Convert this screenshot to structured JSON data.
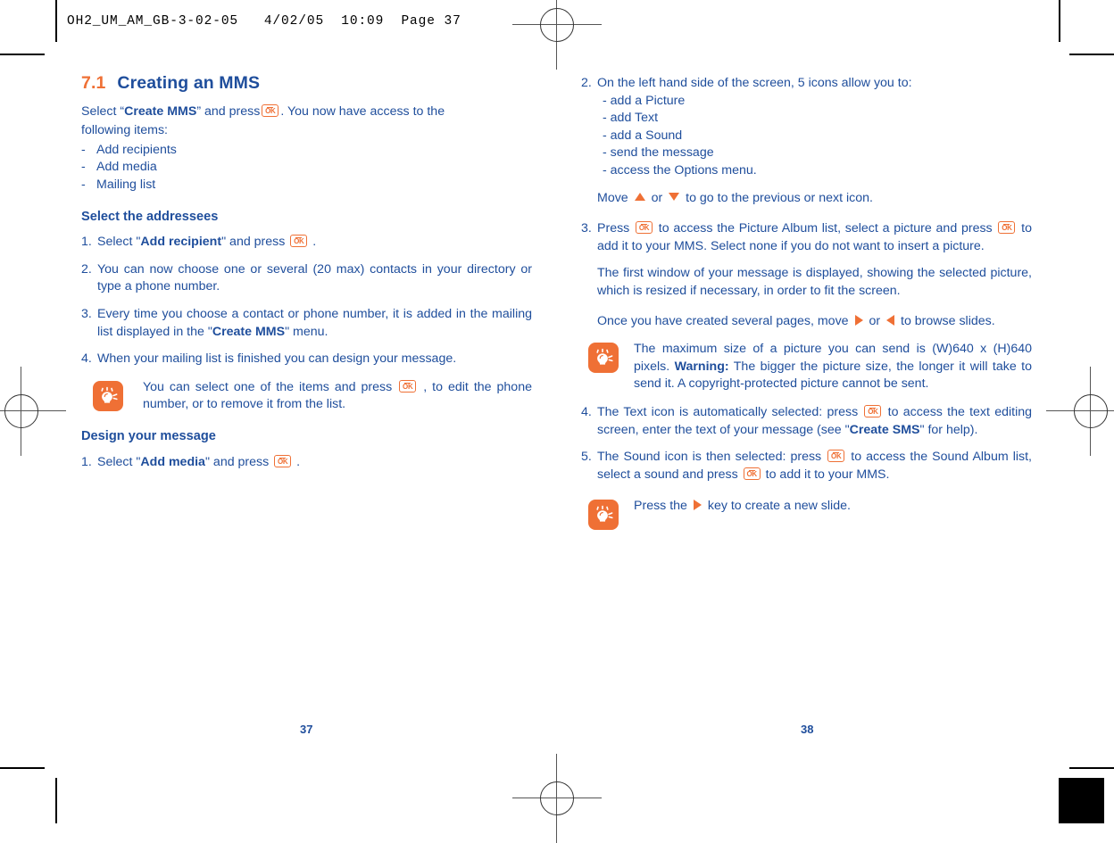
{
  "print_slug": {
    "text": "OH2_UM_AM_GB-3-02-05   4/02/05  10:09  Page 37"
  },
  "colors": {
    "accent_orange": "#ef7035",
    "text_blue": "#1f4e9c",
    "crop_mark": "#000000"
  },
  "left_page": {
    "page_number": "37",
    "chapter": {
      "number": "7.1",
      "title": "Creating an MMS"
    },
    "intro": {
      "before": "Select “",
      "bold": "Create MMS",
      "after_bold": "” and press",
      "after_key": ". You now have access to the",
      "line2": "following items:"
    },
    "items_list": [
      {
        "mark": "-",
        "label": "Add recipients"
      },
      {
        "mark": "-",
        "label": "Add media"
      },
      {
        "mark": "-",
        "label": "Mailing list"
      }
    ],
    "section_addressees": {
      "heading": "Select the addressees",
      "steps": [
        {
          "mark": "1.",
          "before": "Select \"",
          "bold": "Add recipient",
          "after_bold": "\" and press",
          "after_key": "."
        },
        {
          "mark": "2.",
          "text": "You can now choose one or several (20 max) contacts in your directory or type a phone number."
        },
        {
          "mark": "3.",
          "before": "Every time you choose a contact or phone number, it is added in the mailing list displayed in the \"",
          "bold": "Create MMS",
          "after": "\" menu."
        },
        {
          "mark": "4.",
          "text": "When your mailing list is finished you can design your message."
        }
      ],
      "tip": {
        "icon": "lightbulb-icon",
        "before": "You can select one of the items and press",
        "after_key": ", to edit the phone number, or to remove it from the list."
      }
    },
    "section_design": {
      "heading": "Design your message",
      "step": {
        "mark": "1.",
        "before": "Select \"",
        "bold": "Add media",
        "after_bold": "\" and press",
        "after_key": "."
      }
    }
  },
  "right_page": {
    "page_number": "38",
    "step2": {
      "mark": "2.",
      "text": "On the left hand side of the screen, 5 icons allow you to:",
      "sub_items": [
        "- add a Picture",
        "- add Text",
        "- add a Sound",
        "- send the message",
        "- access the Options menu."
      ],
      "move_line": {
        "before": "Move",
        "middle": "or",
        "after": "to go to the previous or next icon."
      }
    },
    "step3": {
      "mark": "3.",
      "before_key": "Press",
      "mid1": "to access the Picture Album list, select a picture and press",
      "mid2": "to add it to your MMS. Select none if you do not want to insert a picture.",
      "para_first_window": "The first window of your message is displayed, showing the selected picture, which is resized if necessary, in order to fit the screen.",
      "browse": {
        "before": "Once you have created several pages, move",
        "middle": "or",
        "after": "to browse slides."
      }
    },
    "tip_max_size": {
      "icon": "lightbulb-icon",
      "before_bold": "The maximum size of a picture you can send is (W)640 x (H)640 pixels. ",
      "bold": "Warning:",
      "after_bold": " The bigger the picture size, the longer it will take to send it. A copyright-protected picture cannot be sent."
    },
    "step4": {
      "mark": "4.",
      "before_key": "The Text icon is automatically selected: press",
      "mid": "to access the text editing screen, enter the text of your message (see \"",
      "bold": "Create SMS",
      "after": "\" for help)."
    },
    "step5": {
      "mark": "5.",
      "before_key": "The Sound icon is then selected: press",
      "mid": "to access the Sound Album list, select a sound and press",
      "after_key": "to add it to your MMS."
    },
    "tip_new_slide": {
      "icon": "lightbulb-icon",
      "before": "Press the",
      "after": "key to create a new slide."
    }
  }
}
